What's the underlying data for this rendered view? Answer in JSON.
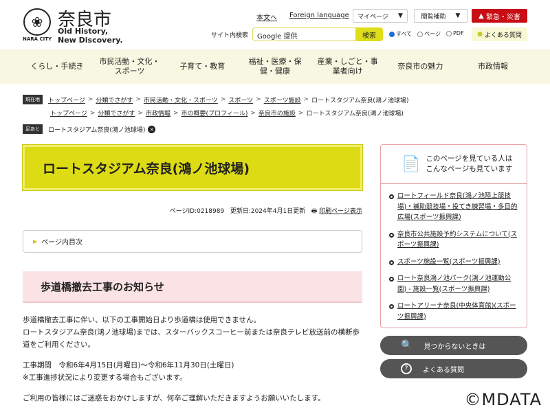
{
  "header": {
    "logo_name": "奈良市",
    "logo_city": "NARA CITY",
    "tagline1": "Old History,",
    "tagline2": "New Discovery.",
    "skip": "本文へ",
    "foreign": "Foreign language",
    "mypage": "マイページ",
    "assist": "閲覧補助",
    "emergency": "緊急・災害",
    "search_label": "サイト内検索",
    "search_placeholder": "Google 提供",
    "search_btn": "検索",
    "radio_all": "すべて",
    "radio_page": "ページ",
    "radio_pdf": "PDF",
    "faq": "よくある質問"
  },
  "nav": [
    "くらし・手続き",
    "市民活動・文化・スポーツ",
    "子育て・教育",
    "福祉・医療・保健・健康",
    "産業・しごと・事業者向け",
    "奈良市の魅力",
    "市政情報"
  ],
  "breadcrumb": {
    "label": "現在地",
    "trail1": [
      "トップページ",
      "分類でさがす",
      "市民活動・文化・スポーツ",
      "スポーツ",
      "スポーツ施設"
    ],
    "trail2": [
      "トップページ",
      "分類でさがす",
      "市政情報",
      "市の概要(プロフィール)",
      "奈良市の施設"
    ],
    "current": "ロートスタジアム奈良(鴻ノ池球場)",
    "footprint_label": "足あと",
    "footprint": "ロートスタジアム奈良(鴻ノ池球場)"
  },
  "page": {
    "title": "ロートスタジアム奈良(鴻ノ池球場)",
    "page_id": "ページID:0218989",
    "updated": "更新日:2024年4月1日更新",
    "print": "印刷ページ表示",
    "toc": "ページ内目次",
    "h2": "歩道橋撤去工事のお知らせ",
    "p1": "歩道橋撤去工事に伴い、以下の工事開始日より歩道橋は使用できません。",
    "p2": "ロートスタジアム奈良(鴻ノ池球場)までは、スターバックスコーヒー前または奈良テレビ放送前の横断歩道をご利用ください。",
    "p3": "工事期間　令和6年4月15日(月曜日)～令和6年11月30日(土曜日)",
    "p4": "※工事進捗状況により変更する場合もございます。",
    "p5": "ご利用の皆様にはご迷惑をおかけしますが、何卒ご理解いただきますようお願いいたします。"
  },
  "sidebar": {
    "heading1": "このページを見ている人は",
    "heading2": "こんなページも見ています",
    "links": [
      "ロートフィールド奈良(鴻ノ池陸上競技場)・補助競技場・投てき練習場・多目的広場(スポーツ振興課)",
      "奈良市公共施設予約システムについて(スポーツ振興課)",
      "スポーツ施設一覧(スポーツ振興課)",
      "ロート奈良鴻ノ池パーク(鴻ノ池運動公園) - 施設一覧(スポーツ振興課)",
      "ロートアリーナ奈良(中央体育館)(スポーツ振興課)"
    ],
    "not_found": "見つからないときは",
    "faq": "よくある質問"
  },
  "watermark": "©MDATA"
}
